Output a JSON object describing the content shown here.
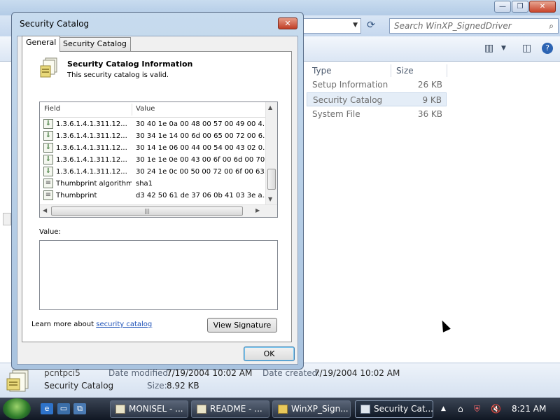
{
  "explorer": {
    "search_placeholder": "Search WinXP_SignedDriver",
    "columns": [
      "Type",
      "Size"
    ],
    "files": [
      {
        "type": "Setup Information",
        "size": "26 KB"
      },
      {
        "type": "Security Catalog",
        "size": "9 KB"
      },
      {
        "type": "System File",
        "size": "36 KB"
      }
    ],
    "selected_file_index": 1
  },
  "details_pane": {
    "filename": "pcntpci5",
    "date_modified_label": "Date modified:",
    "date_modified": "7/19/2004 10:02 AM",
    "date_created_label": "Date created:",
    "date_created": "7/19/2004 10:02 AM",
    "file_type": "Security Catalog",
    "size_label": "Size:",
    "size": "8.92 KB"
  },
  "dialog": {
    "title": "Security Catalog",
    "close_label": "✕",
    "tabs": [
      {
        "label": "General",
        "active": true
      },
      {
        "label": "Security Catalog",
        "active": false
      }
    ],
    "info_title": "Security Catalog Information",
    "info_subtitle": "This security catalog is valid.",
    "list_columns": {
      "field": "Field",
      "value": "Value"
    },
    "list_rows": [
      {
        "field": "1.3.6.1.4.1.311.12...",
        "value": "30 40 1e 0a 00 48 00 57 00 49 00 4...",
        "icon": "download-ext-icon"
      },
      {
        "field": "1.3.6.1.4.1.311.12...",
        "value": "30 34 1e 14 00 6d 00 65 00 72 00 6...",
        "icon": "download-ext-icon"
      },
      {
        "field": "1.3.6.1.4.1.311.12...",
        "value": "30 14 1e 06 00 44 00 54 00 43 02 0...",
        "icon": "download-ext-icon"
      },
      {
        "field": "1.3.6.1.4.1.311.12...",
        "value": "30 1e 1e 0e 00 43 00 6f 00 6d 00 70...",
        "icon": "download-ext-icon"
      },
      {
        "field": "1.3.6.1.4.1.311.12...",
        "value": "30 24 1e 0c 00 50 00 72 00 6f 00 63...",
        "icon": "download-ext-icon"
      },
      {
        "field": "Thumbprint algorithm",
        "value": "sha1",
        "icon": "property-icon"
      },
      {
        "field": "Thumbprint",
        "value": "d3 42 50 61 de 37 06 0b 41 03 3e a...",
        "icon": "property-icon"
      }
    ],
    "value_label": "Value:",
    "learn_prefix": "Learn more about ",
    "learn_link": "security catalog",
    "view_signature_label": "View Signature",
    "ok_label": "OK"
  },
  "taskbar": {
    "items": [
      {
        "label": "MONISEL - ...",
        "active": false
      },
      {
        "label": "README - ...",
        "active": false
      },
      {
        "label": "WinXP_Sign...",
        "active": false
      },
      {
        "label": "Security Cat...",
        "active": true
      }
    ],
    "clock": "8:21 AM"
  }
}
